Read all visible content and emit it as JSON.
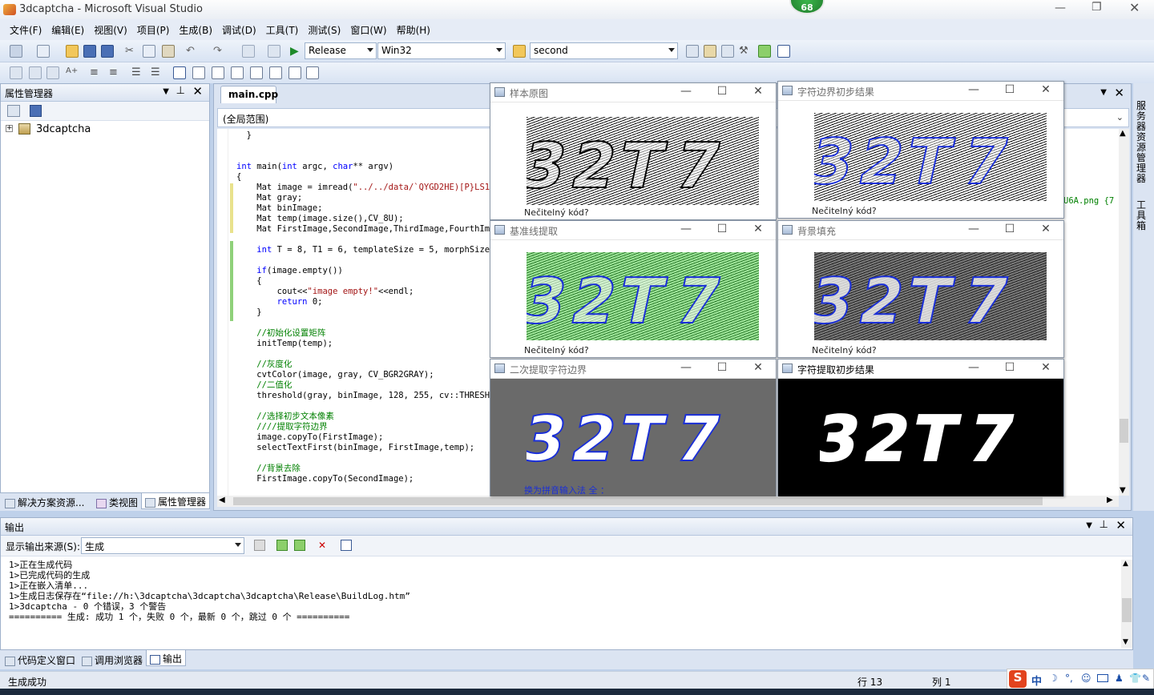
{
  "app": {
    "title": "3dcaptcha - Microsoft Visual Studio",
    "badge": "68"
  },
  "menu": [
    "文件(F)",
    "编辑(E)",
    "视图(V)",
    "项目(P)",
    "生成(B)",
    "调试(D)",
    "工具(T)",
    "测试(S)",
    "窗口(W)",
    "帮助(H)"
  ],
  "toolbar": {
    "config": "Release",
    "platform": "Win32",
    "find": "second"
  },
  "left_panel": {
    "title": "属性管理器",
    "tree_item": "3dcaptcha",
    "tabs": [
      "解决方案资源...",
      "类视图",
      "属性管理器"
    ]
  },
  "editor": {
    "tab": "main.cpp",
    "scope": "(全局范围)",
    "right_fragment": "U6A.png {7"
  },
  "right_sidebar": [
    "服务器资源管理器",
    "工具箱"
  ],
  "code_lines": [
    {
      "t": "  }",
      "c": "n"
    },
    {
      "t": "",
      "c": "n"
    },
    {
      "t": "",
      "c": "n"
    },
    {
      "t": "int main(int argc, char** argv)",
      "c": "k"
    },
    {
      "t": "{",
      "c": "n"
    },
    {
      "t": "    Mat image = imread(\"../../data/`QYGD2HE)[P}LS1FQ\")",
      "c": "s"
    },
    {
      "t": "    Mat gray;",
      "c": "n"
    },
    {
      "t": "    Mat binImage;",
      "c": "n"
    },
    {
      "t": "    Mat temp(image.size(),CV_8U);",
      "c": "n"
    },
    {
      "t": "    Mat FirstImage,SecondImage,ThirdImage,FourthImgae",
      "c": "n"
    },
    {
      "t": "",
      "c": "n"
    },
    {
      "t": "    int T = 8, T1 = 6, templateSize = 5, morphSize=3,",
      "c": "k"
    },
    {
      "t": "",
      "c": "n"
    },
    {
      "t": "    if(image.empty())",
      "c": "k"
    },
    {
      "t": "    {",
      "c": "n"
    },
    {
      "t": "        cout<<\"image empty!\"<<endl;",
      "c": "s"
    },
    {
      "t": "        return 0;",
      "c": "k"
    },
    {
      "t": "    }",
      "c": "n"
    },
    {
      "t": "",
      "c": "n"
    },
    {
      "t": "    //初始化设置矩阵",
      "c": "c"
    },
    {
      "t": "    initTemp(temp);",
      "c": "n"
    },
    {
      "t": "",
      "c": "n"
    },
    {
      "t": "    //灰度化",
      "c": "c"
    },
    {
      "t": "    cvtColor(image, gray, CV_BGR2GRAY);",
      "c": "n"
    },
    {
      "t": "    //二值化",
      "c": "c"
    },
    {
      "t": "    threshold(gray, binImage, 128, 255, cv::THRESH_BI",
      "c": "n"
    },
    {
      "t": "",
      "c": "n"
    },
    {
      "t": "    //选择初步文本像素",
      "c": "c"
    },
    {
      "t": "    ////提取字符边界",
      "c": "c"
    },
    {
      "t": "    image.copyTo(FirstImage);",
      "c": "n"
    },
    {
      "t": "    selectTextFirst(binImage, FirstImage,temp);",
      "c": "n"
    },
    {
      "t": "",
      "c": "n"
    },
    {
      "t": "    //背景去除",
      "c": "c"
    },
    {
      "t": "    FirstImage.copyTo(SecondImage);",
      "c": "n"
    }
  ],
  "windows": [
    {
      "title": "样本原图",
      "caption": "Nečitelný kód?"
    },
    {
      "title": "字符边界初步结果",
      "caption": "Nečitelný kód?"
    },
    {
      "title": "基准线提取",
      "caption": "Nečitelný kód?"
    },
    {
      "title": "背景填充",
      "caption": "Nečitelný kód?"
    },
    {
      "title": "二次提取字符边界",
      "caption": "换为拼音输入法 全 ："
    },
    {
      "title": "字符提取初步结果",
      "caption": ""
    }
  ],
  "output": {
    "title": "输出",
    "source_label": "显示输出来源(S):",
    "source_value": "生成",
    "lines": [
      "1>正在生成代码",
      "1>已完成代码的生成",
      "1>正在嵌入清单...",
      "1>生成日志保存在“file://h:\\3dcaptcha\\3dcaptcha\\3dcaptcha\\Release\\BuildLog.htm”",
      "1>3dcaptcha - 0 个错误，3 个警告",
      "========== 生成: 成功 1 个，失败 0 个，最新 0 个，跳过 0 个 =========="
    ],
    "tabs": [
      "代码定义窗口",
      "调用浏览器",
      "输出"
    ]
  },
  "status": {
    "message": "生成成功",
    "row": "行 13",
    "col": "列 1",
    "ime": "中"
  }
}
